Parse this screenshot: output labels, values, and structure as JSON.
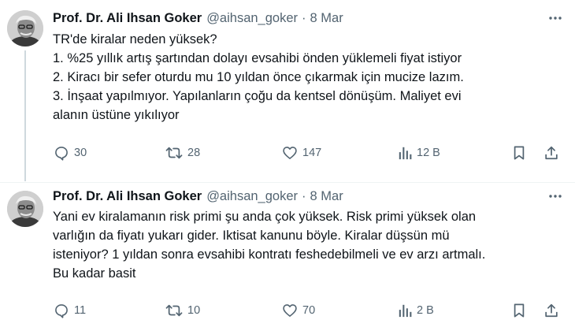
{
  "tweets": [
    {
      "author_name": "Prof. Dr. Ali Ihsan Goker",
      "handle": "@aihsan_goker",
      "separator": "·",
      "date": "8 Mar",
      "lines": [
        "TR'de kiralar neden yüksek?",
        "1. %25 yıllık artış şartından dolayı evsahibi önden yüklemeli fiyat istiyor",
        "2. Kiracı bir sefer oturdu mu 10 yıldan önce çıkarmak için mucize lazım.",
        "3. İnşaat yapılmıyor. Yapılanların çoğu da kentsel dönüşüm. Maliyet evi",
        "alanın üstüne yıkılıyor"
      ],
      "replies": "30",
      "retweets": "28",
      "likes": "147",
      "views": "12 B"
    },
    {
      "author_name": "Prof. Dr. Ali Ihsan Goker",
      "handle": "@aihsan_goker",
      "separator": "·",
      "date": "8 Mar",
      "lines": [
        "Yani ev kiralamanın risk primi şu anda çok yüksek. Risk primi yüksek olan",
        "varlığın da fiyatı yukarı gider. Iktisat kanunu böyle. Kiralar düşsün mü",
        "isteniyor? 1 yıldan sonra evsahibi kontratı feshedebilmeli ve ev arzı artmalı.",
        "Bu kadar basit"
      ],
      "replies": "11",
      "retweets": "10",
      "likes": "70",
      "views": "2 B"
    }
  ],
  "icons": {
    "more": "more-icon",
    "reply": "reply-icon",
    "retweet": "retweet-icon",
    "like": "heart-icon",
    "views": "views-icon",
    "bookmark": "bookmark-icon",
    "share": "share-icon"
  },
  "colors": {
    "text": "#0f1419",
    "secondary": "#536471",
    "thread_line": "#cfd9de"
  }
}
